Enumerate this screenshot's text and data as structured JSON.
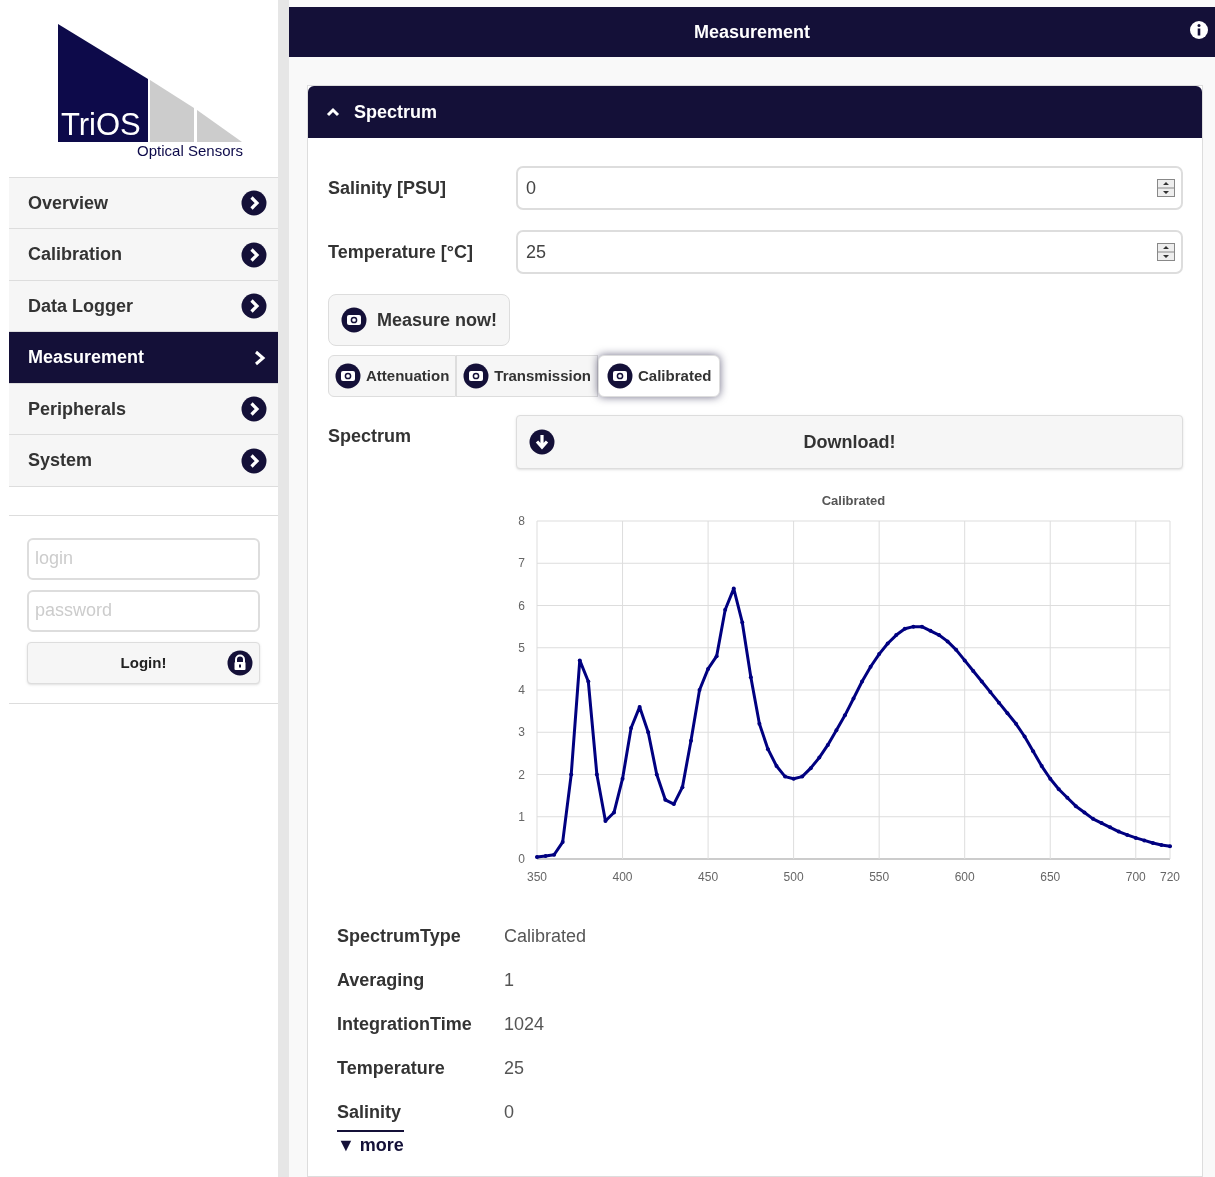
{
  "logo": {
    "wordmark": "TriOS",
    "tagline": "Optical Sensors"
  },
  "nav": [
    {
      "label": "Overview",
      "selected": false
    },
    {
      "label": "Calibration",
      "selected": false
    },
    {
      "label": "Data Logger",
      "selected": false
    },
    {
      "label": "Measurement",
      "selected": true
    },
    {
      "label": "Peripherals",
      "selected": false
    },
    {
      "label": "System",
      "selected": false
    }
  ],
  "login": {
    "user_placeholder": "login",
    "password_placeholder": "password",
    "button": "Login!"
  },
  "header": {
    "title": "Measurement"
  },
  "panel": {
    "title": "Spectrum",
    "expanded": true,
    "fields": [
      {
        "label": "Salinity [PSU]",
        "value": "0"
      },
      {
        "label": "Temperature [°C]",
        "value": "25"
      }
    ],
    "measure_button": "Measure now!",
    "modes": [
      {
        "label": "Attenuation",
        "selected": false
      },
      {
        "label": "Transmission",
        "selected": false
      },
      {
        "label": "Calibrated",
        "selected": true
      }
    ],
    "spectrum_label": "Spectrum",
    "download_button": "Download!",
    "chart_data": {
      "type": "line",
      "title": "Calibrated",
      "xlim": [
        350,
        720
      ],
      "ylim": [
        0,
        8
      ],
      "xticks": [
        350,
        400,
        450,
        500,
        550,
        600,
        650,
        700,
        720
      ],
      "yticks": [
        0,
        1,
        2,
        3,
        4,
        5,
        6,
        7,
        8
      ],
      "x": [
        350,
        355,
        360,
        365,
        370,
        375,
        380,
        385,
        390,
        395,
        400,
        405,
        410,
        415,
        420,
        425,
        430,
        435,
        440,
        445,
        450,
        455,
        460,
        465,
        470,
        475,
        480,
        485,
        490,
        495,
        500,
        505,
        510,
        515,
        520,
        525,
        530,
        535,
        540,
        545,
        550,
        555,
        560,
        565,
        570,
        575,
        580,
        585,
        590,
        595,
        600,
        605,
        610,
        615,
        620,
        625,
        630,
        635,
        640,
        645,
        650,
        655,
        660,
        665,
        670,
        675,
        680,
        685,
        690,
        695,
        700,
        705,
        710,
        715,
        720
      ],
      "grid": true,
      "series": [
        {
          "color": "#000080",
          "values": [
            0.05,
            0.07,
            0.1,
            0.4,
            2.0,
            4.7,
            4.2,
            2.0,
            0.9,
            1.1,
            1.9,
            3.1,
            3.6,
            3.0,
            2.0,
            1.4,
            1.3,
            1.7,
            2.8,
            4.0,
            4.5,
            4.8,
            5.9,
            6.4,
            5.6,
            4.3,
            3.2,
            2.6,
            2.2,
            1.95,
            1.9,
            1.95,
            2.15,
            2.4,
            2.7,
            3.05,
            3.4,
            3.8,
            4.2,
            4.55,
            4.85,
            5.1,
            5.3,
            5.45,
            5.5,
            5.5,
            5.4,
            5.3,
            5.15,
            4.95,
            4.7,
            4.45,
            4.2,
            3.95,
            3.7,
            3.45,
            3.2,
            2.9,
            2.55,
            2.2,
            1.9,
            1.65,
            1.45,
            1.25,
            1.1,
            0.95,
            0.85,
            0.75,
            0.65,
            0.57,
            0.5,
            0.44,
            0.38,
            0.33,
            0.3
          ]
        }
      ]
    },
    "info": [
      {
        "key": "SpectrumType",
        "value": "Calibrated"
      },
      {
        "key": "Averaging",
        "value": "1"
      },
      {
        "key": "IntegrationTime",
        "value": "1024"
      },
      {
        "key": "Temperature",
        "value": "25"
      },
      {
        "key": "Salinity",
        "value": "0"
      }
    ],
    "more": "▼ more"
  }
}
